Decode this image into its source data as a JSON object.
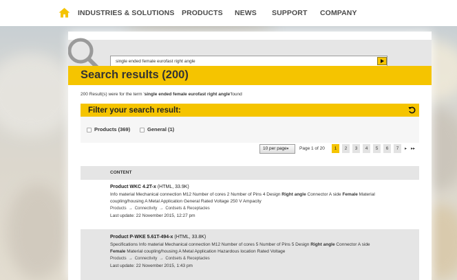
{
  "nav": {
    "items": [
      "INDUSTRIES & SOLUTIONS",
      "PRODUCTS",
      "NEWS",
      "SUPPORT",
      "COMPANY"
    ],
    "home_icon": "home-icon",
    "accent_color": "#f5c400"
  },
  "search": {
    "value": "single ended female eurofast right angle",
    "button_icon": "arrow-right-icon"
  },
  "results": {
    "title": "Search results (200)",
    "note_prefix": "200 Result(s) were for the term '",
    "note_term": "single ended female eurofast right angle",
    "note_suffix": "'found"
  },
  "filter": {
    "title": "Filter your search result:",
    "reset_icon": "reset-icon",
    "options": [
      {
        "label": "Products (369)",
        "checked": false
      },
      {
        "label": "General (1)",
        "checked": false
      }
    ]
  },
  "pagination": {
    "per_page": "10 per page",
    "page_of": "Page 1 of 20",
    "pages": [
      "1",
      "2",
      "3",
      "4",
      "5",
      "6",
      "7"
    ],
    "active_page": "1",
    "next": "▸",
    "last": "▸▸"
  },
  "table": {
    "header": "CONTENT",
    "rows": [
      {
        "title": "Product WKC 4.2T-x",
        "meta": " (HTML, 33.9K)",
        "line1_a": "Info material Mechanical connection M12 Number of cores 2 Number of Pins 4 Design ",
        "line1_b": "Right angle",
        "line1_c": " Connector A side ",
        "line1_d": "Female",
        "line1_e": " Material",
        "line2": "coupling/housing A Metal Application General Rated Voltage 250 V Ampacity",
        "crumbs": [
          "Products",
          "Connectivity",
          "Cordsets & Receptacles"
        ],
        "updated": "Last update: 22 November 2015, 12:27 pm"
      },
      {
        "title": "Product P-WKE 5.61T-494-x",
        "meta": " (HTML, 33.8K)",
        "line1_a": "Specifications Info material Mechanical connection M12 Number of cores 5 Number of Pins 5 Design ",
        "line1_b": "Right angle",
        "line1_c": " Connector A side",
        "line2_a": "Female",
        "line2_b": " Material coupling/housing A Metal Application Hazardous location Rated Voltage",
        "crumbs": [
          "Products",
          "Connectivity",
          "Cordsets & Receptacles"
        ],
        "updated": "Last update: 22 November 2015, 1:43 pm"
      }
    ]
  }
}
